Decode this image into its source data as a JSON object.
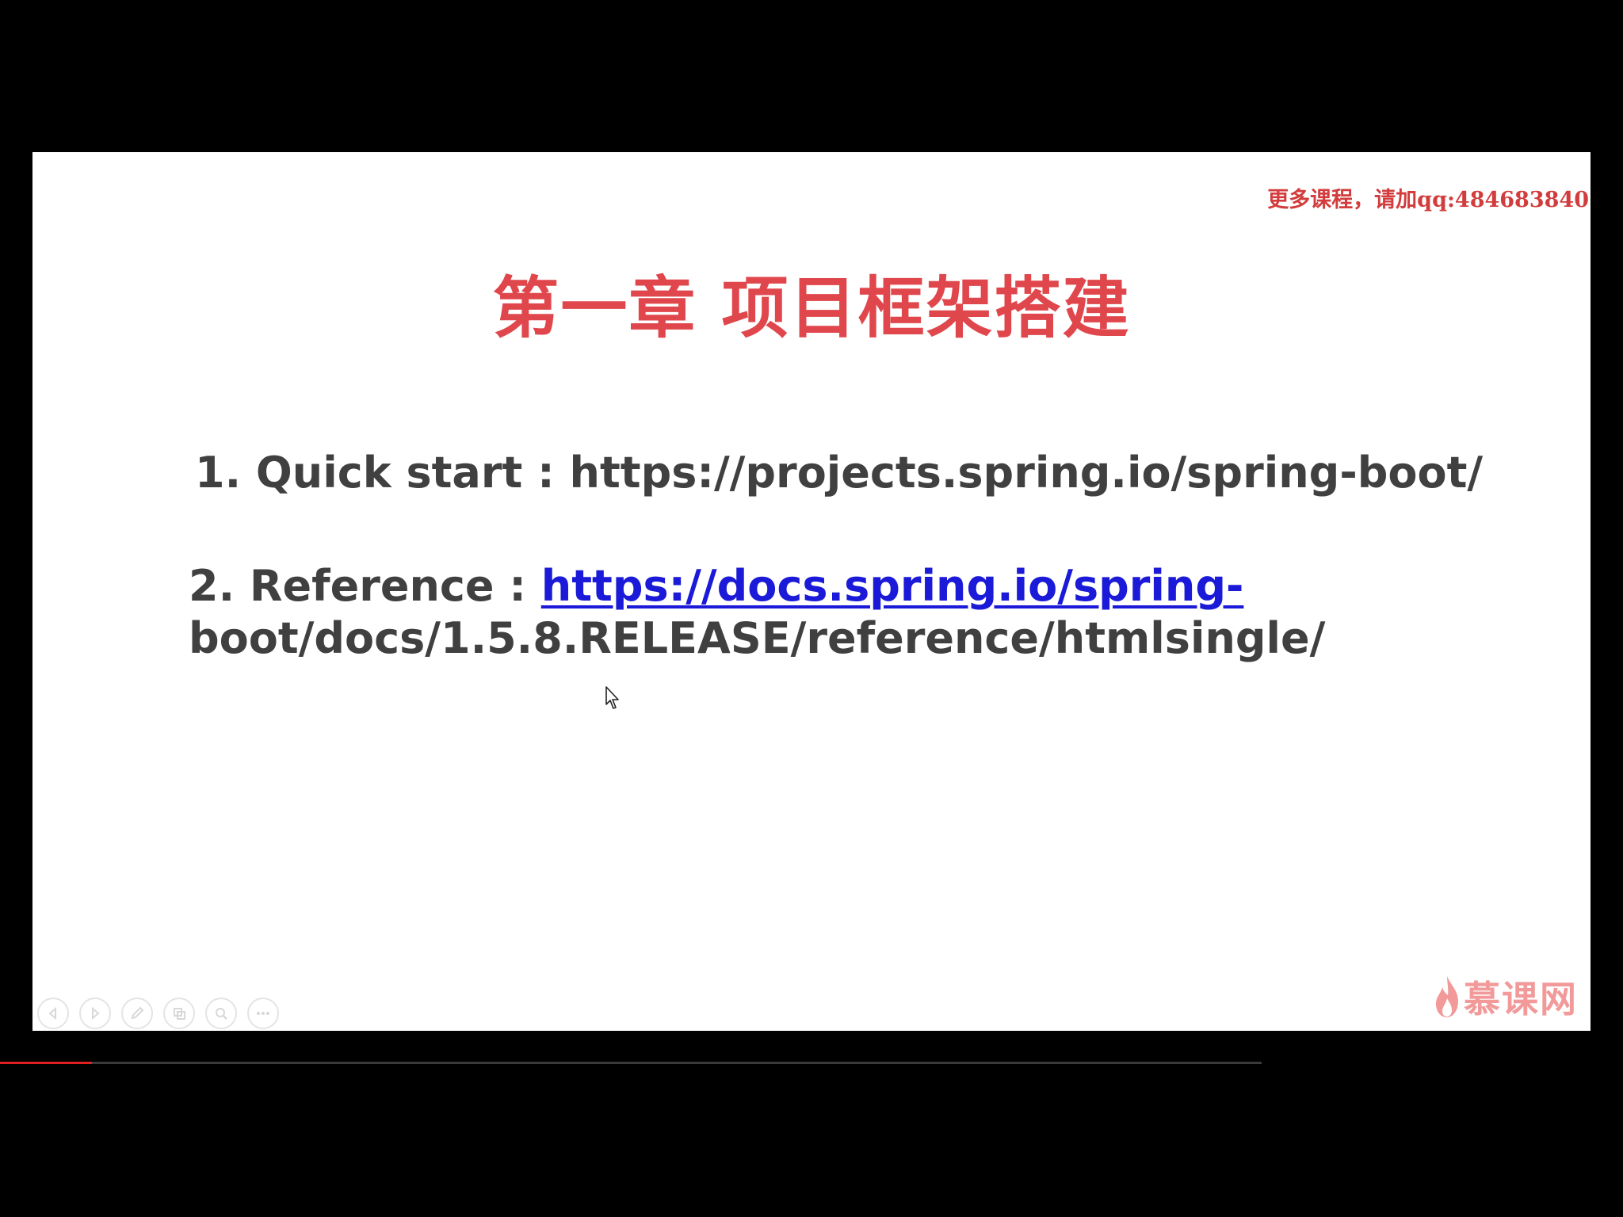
{
  "slide": {
    "watermark": "更多课程，请加qq:484683840",
    "title": "第一章 项目框架搭建",
    "items": [
      {
        "prefix": "1. Quick start : https://projects.spring.io/spring-boot/"
      },
      {
        "prefix": "2. Reference : ",
        "link": "https://docs.spring.io/spring-",
        "continuation": "boot/docs/1.5.8.RELEASE/reference/htmlsingle/"
      }
    ],
    "logo_text": "慕课网"
  },
  "toolbar": {
    "buttons": [
      {
        "icon": "previous-icon"
      },
      {
        "icon": "next-icon"
      },
      {
        "icon": "pen-icon"
      },
      {
        "icon": "slides-icon"
      },
      {
        "icon": "zoom-icon"
      },
      {
        "icon": "more-icon"
      }
    ]
  },
  "player": {
    "progress": 0.073
  },
  "colors": {
    "title": "#e0474c",
    "watermark": "#d23c3c",
    "body_text": "#404040",
    "link": "#1a1ad8",
    "logo": "#f29a9a",
    "progress": "#e02020"
  }
}
